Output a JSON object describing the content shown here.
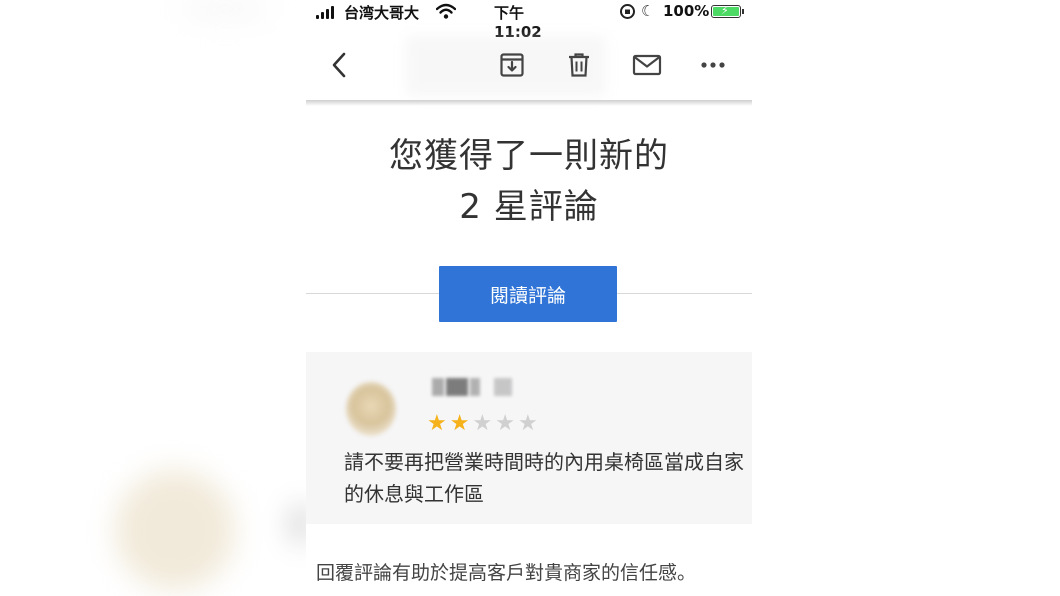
{
  "status_bar": {
    "carrier": "台湾大哥大",
    "time": "下午 11:02",
    "battery": "100%"
  },
  "toolbar": {
    "icons": [
      "back-arrow-icon",
      "archive-icon",
      "trash-icon",
      "mail-icon",
      "more-icon"
    ]
  },
  "headline": {
    "line1": "您獲得了一則新的",
    "line2": "2 星評論"
  },
  "read_button": {
    "label": "閱讀評論",
    "color": "#2f74d6"
  },
  "review": {
    "rating": 2,
    "max_rating": 5,
    "text": "請不要再把營業時間時的內用桌椅區當成自家的休息與工作區",
    "star_color": "#f5b21b"
  },
  "footer_note": "回覆評論有助於提高客戶對貴商家的信任感。"
}
